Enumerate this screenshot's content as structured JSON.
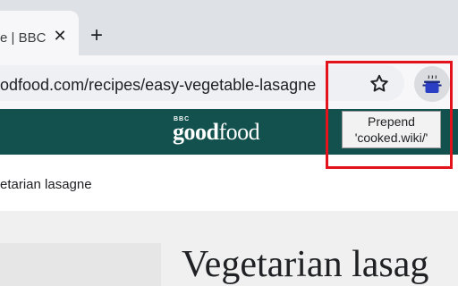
{
  "browser": {
    "tab": {
      "title": "e | BBC",
      "close_glyph": "✕"
    },
    "new_tab_glyph": "+",
    "omnibox": {
      "url": "odfood.com/recipes/easy-vegetable-lasagne"
    },
    "icons": {
      "bookmark": "star-icon",
      "extension": "cooking-pot-icon"
    }
  },
  "extension_popup": {
    "line1": "Prepend",
    "line2": "'cooked.wiki/'"
  },
  "site": {
    "bbc_mark": "BBC",
    "logo_bold": "good",
    "logo_light": "food",
    "header_color": "#12514d"
  },
  "breadcrumb": "etarian lasagne",
  "recipe": {
    "title": "Vegetarian lasag"
  },
  "colors": {
    "highlight": "#e3121b",
    "extension_pot": "#2a3fc4"
  }
}
